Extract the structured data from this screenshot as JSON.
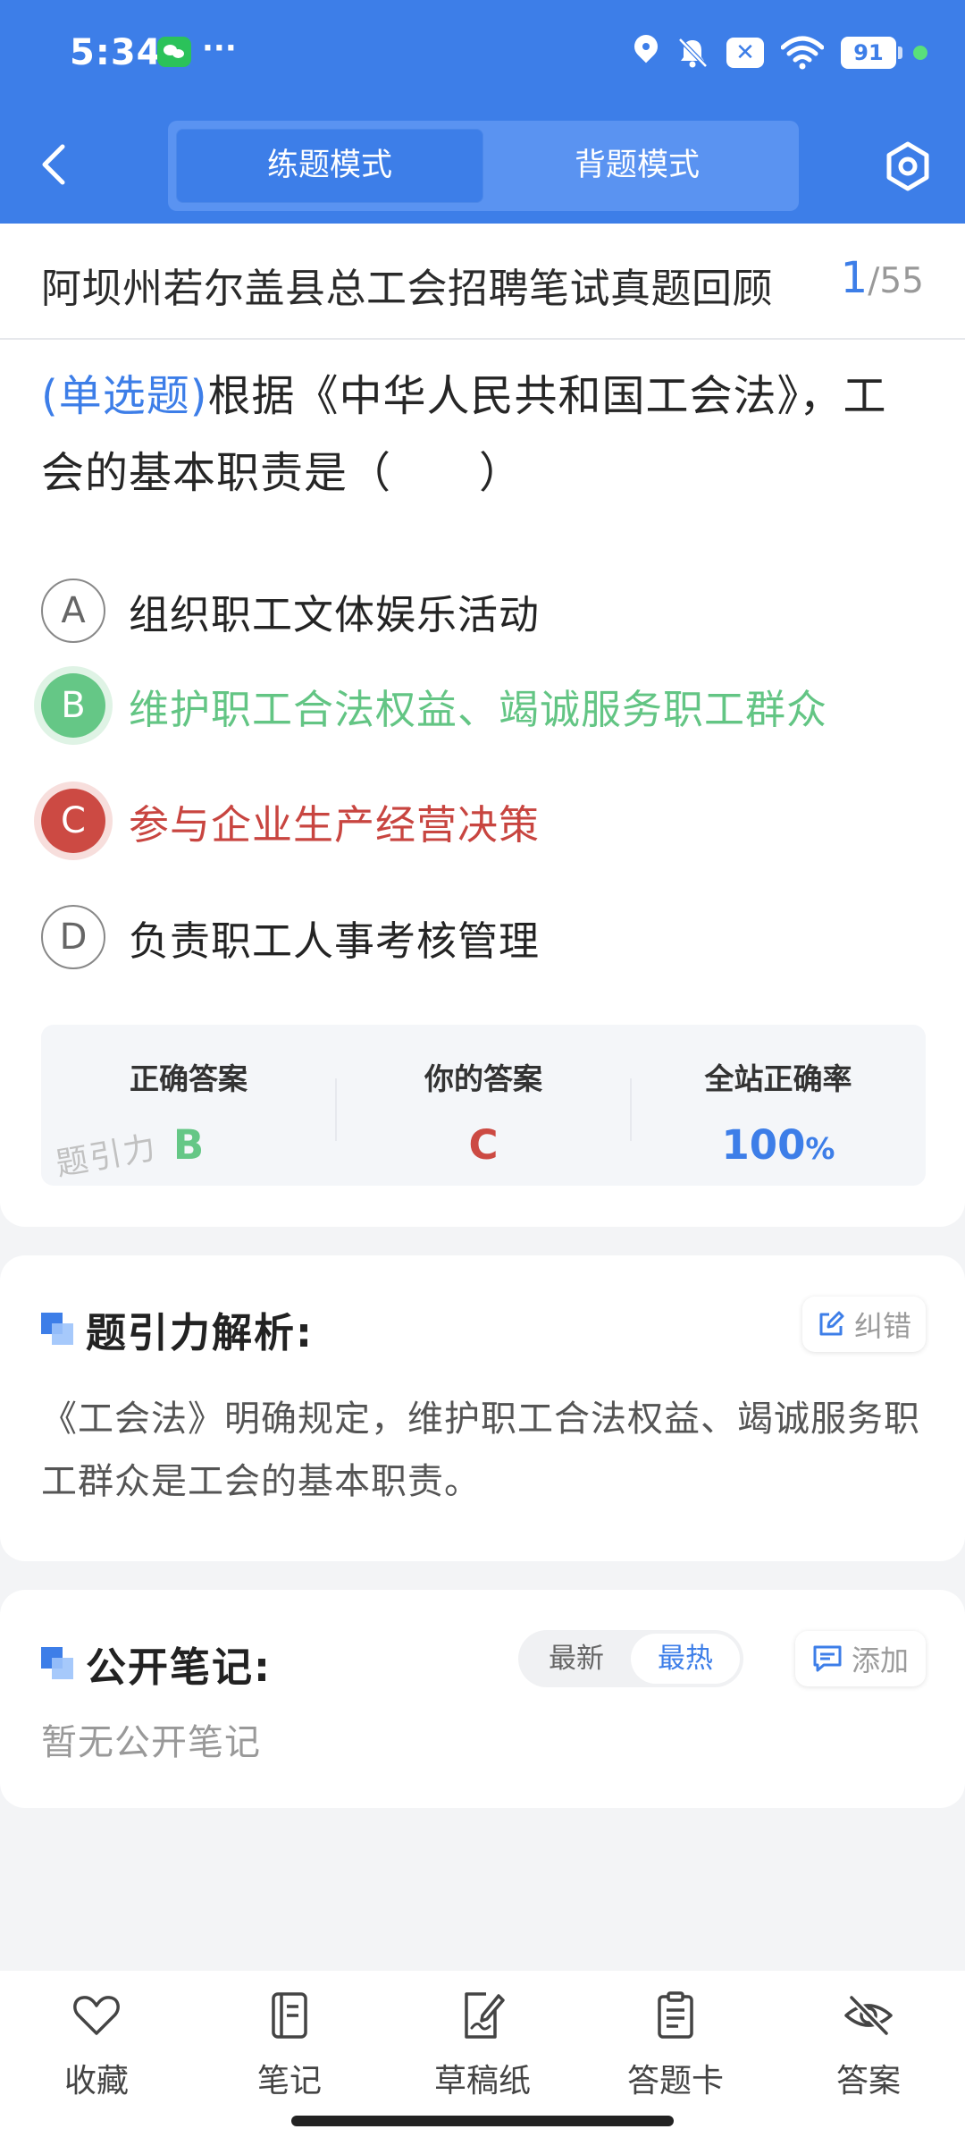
{
  "status_bar": {
    "time": "5:34",
    "dots": "···",
    "battery": "91"
  },
  "header": {
    "tabs": [
      {
        "label": "练题模式",
        "active": true
      },
      {
        "label": "背题模式",
        "active": false
      }
    ]
  },
  "paper": {
    "title": "阿坝州若尔盖县总工会招聘笔试真题回顾",
    "current": "1",
    "separator": "/",
    "total": "55"
  },
  "question": {
    "type": "(单选题)",
    "text": "根据《中华人民共和国工会法》，工会的基本职责是（　　）"
  },
  "options": [
    {
      "letter": "A",
      "text": "组织职工文体娱乐活动",
      "state": "normal"
    },
    {
      "letter": "B",
      "text": "维护职工合法权益、竭诚服务职工群众",
      "state": "correct"
    },
    {
      "letter": "C",
      "text": "参与企业生产经营决策",
      "state": "wrong"
    },
    {
      "letter": "D",
      "text": "负责职工人事考核管理",
      "state": "normal"
    }
  ],
  "answer_summary": {
    "correct_label": "正确答案",
    "correct_value": "B",
    "yours_label": "你的答案",
    "yours_value": "C",
    "rate_label": "全站正确率",
    "rate_value": "100",
    "rate_unit": "%",
    "watermark": "题引力"
  },
  "analysis": {
    "title": "题引力解析:",
    "correct_button": "纠错",
    "text": "《工会法》明确规定，维护职工合法权益、竭诚服务职工群众是工会的基本职责。"
  },
  "notes": {
    "title": "公开笔记:",
    "sort_options": [
      "最新",
      "最热"
    ],
    "add_button": "添加",
    "empty_text": "暂无公开笔记"
  },
  "tabbar": [
    {
      "label": "收藏",
      "icon": "heart-icon"
    },
    {
      "label": "笔记",
      "icon": "notebook-icon"
    },
    {
      "label": "草稿纸",
      "icon": "draft-paper-icon"
    },
    {
      "label": "答题卡",
      "icon": "answer-sheet-icon"
    },
    {
      "label": "答案",
      "icon": "eye-off-icon"
    }
  ],
  "colors": {
    "primary": "#3d7ee8",
    "correct": "#65c786",
    "wrong": "#cc4a43"
  }
}
